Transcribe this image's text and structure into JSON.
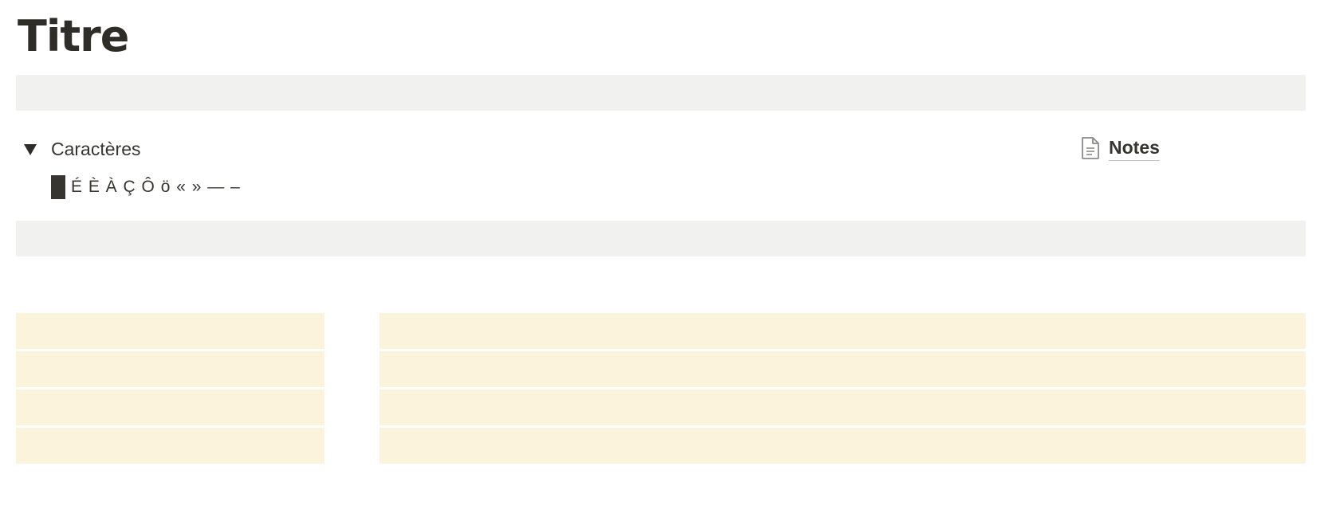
{
  "page": {
    "title": "Titre"
  },
  "toggle": {
    "label": "Caractères",
    "expanded": true,
    "content": "É È À Ç Ô ö « » — –"
  },
  "notes_link": {
    "label": "Notes",
    "icon": "document-icon"
  },
  "colors": {
    "gray_block": "#f1f1ef",
    "yellow_block": "#fbf3db",
    "text": "#37352f"
  }
}
